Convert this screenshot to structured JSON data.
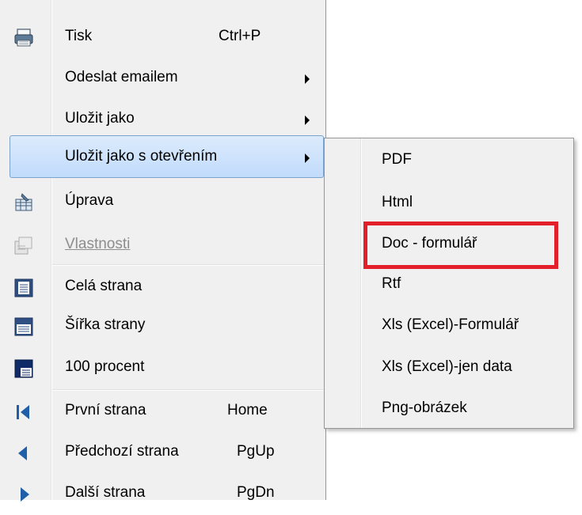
{
  "menu": {
    "items": [
      {
        "label": "Tisk",
        "shortcut": "Ctrl+P",
        "icon": "printer-icon",
        "submenu": false
      },
      {
        "label": "Odeslat emailem",
        "shortcut": "",
        "icon": "",
        "submenu": true
      },
      {
        "label": "Uložit jako",
        "shortcut": "",
        "icon": "",
        "submenu": true
      },
      {
        "label": "Uložit jako s otevřením",
        "shortcut": "",
        "icon": "",
        "submenu": true,
        "highlighted": true
      },
      {
        "label": "Úprava",
        "shortcut": "",
        "icon": "edit-icon",
        "submenu": false
      },
      {
        "label": "Vlastnosti",
        "shortcut": "",
        "icon": "properties-icon",
        "submenu": false,
        "disabled": true
      },
      {
        "label": "Celá strana",
        "shortcut": "",
        "icon": "whole-page-icon",
        "submenu": false
      },
      {
        "label": "Šířka strany",
        "shortcut": "",
        "icon": "page-width-icon",
        "submenu": false
      },
      {
        "label": "100 procent",
        "shortcut": "",
        "icon": "zoom-100-icon",
        "submenu": false
      },
      {
        "label": "První strana",
        "shortcut": "Home",
        "icon": "first-page-icon",
        "submenu": false
      },
      {
        "label": "Předchozí strana",
        "shortcut": "PgUp",
        "icon": "previous-page-icon",
        "submenu": false
      },
      {
        "label": "Další strana",
        "shortcut": "PgDn",
        "icon": "next-page-icon",
        "submenu": false
      }
    ]
  },
  "submenu": {
    "items": [
      {
        "label": "PDF"
      },
      {
        "label": "Html"
      },
      {
        "label": "Doc - formulář",
        "highlighted_box": true
      },
      {
        "label": "Rtf"
      },
      {
        "label": "Xls (Excel)-Formulář"
      },
      {
        "label": "Xls (Excel)-jen data"
      },
      {
        "label": "Png-obrázek"
      }
    ]
  },
  "colors": {
    "highlight_box": "#e3202a",
    "selection": "#c1dbfc",
    "menu_bg": "#f0f0f0",
    "disabled_text": "#8d8d8d"
  }
}
